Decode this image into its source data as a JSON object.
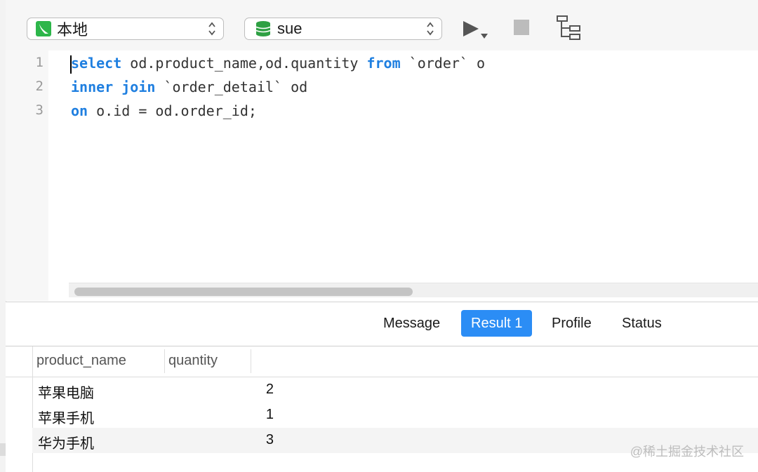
{
  "toolbar": {
    "connection": "本地",
    "database": "sue"
  },
  "editor": {
    "line_numbers": [
      "1",
      "2",
      "3"
    ],
    "lines": [
      [
        {
          "text": "select",
          "kw": true
        },
        {
          "text": " od.product_name,od.quantity ",
          "kw": false
        },
        {
          "text": "from",
          "kw": true
        },
        {
          "text": " `order` o",
          "kw": false
        }
      ],
      [
        {
          "text": "inner join",
          "kw": true
        },
        {
          "text": " `order_detail` od",
          "kw": false
        }
      ],
      [
        {
          "text": "on",
          "kw": true
        },
        {
          "text": " o.id = od.order_id;",
          "kw": false
        }
      ]
    ]
  },
  "tabs": [
    "Message",
    "Result 1",
    "Profile",
    "Status"
  ],
  "active_tab": "Result 1",
  "results": {
    "columns": [
      "product_name",
      "quantity"
    ],
    "rows": [
      {
        "product_name": "苹果电脑",
        "quantity": "2"
      },
      {
        "product_name": "苹果手机",
        "quantity": "1"
      },
      {
        "product_name": "华为手机",
        "quantity": "3"
      }
    ]
  },
  "watermark": "@稀土掘金技术社区",
  "colors": {
    "accent": "#2b8df5",
    "keyword": "#1f7fe0",
    "connection_icon": "#2db64a",
    "database_icon": "#2ea043"
  },
  "icons": {
    "connection": "connection-leaf-icon",
    "database": "database-stack-icon",
    "run": "run-play-icon",
    "stop": "stop-square-icon",
    "explain": "explain-tree-icon"
  }
}
